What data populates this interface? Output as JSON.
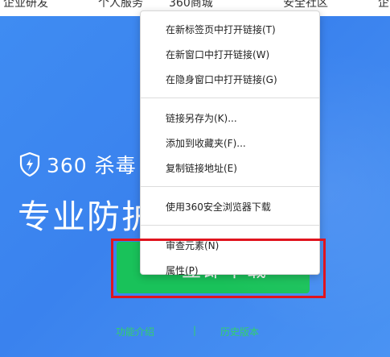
{
  "topnav": {
    "items": [
      "企业研发",
      "个人服务",
      "360商城",
      "安全社区",
      "企"
    ]
  },
  "hero": {
    "brand": "360 杀毒",
    "headline": "专业防护 守护您",
    "download_label": "立即下载",
    "link_left": "功能介绍",
    "link_separator": "|",
    "link_right": "历史版本",
    "colors": {
      "banner": "#3f8cf2",
      "button": "#19c25a",
      "link": "#33d06a"
    }
  },
  "context_menu": {
    "groups": [
      [
        "在新标签页中打开链接(T)",
        "在新窗口中打开链接(W)",
        "在隐身窗口中打开链接(G)"
      ],
      [
        "链接另存为(K)...",
        "添加到收藏夹(F)...",
        "复制链接地址(E)"
      ],
      [
        "使用360安全浏览器下载"
      ],
      [
        "审查元素(N)",
        "属性(P)"
      ]
    ]
  },
  "highlight": {
    "color": "#e0141e"
  }
}
